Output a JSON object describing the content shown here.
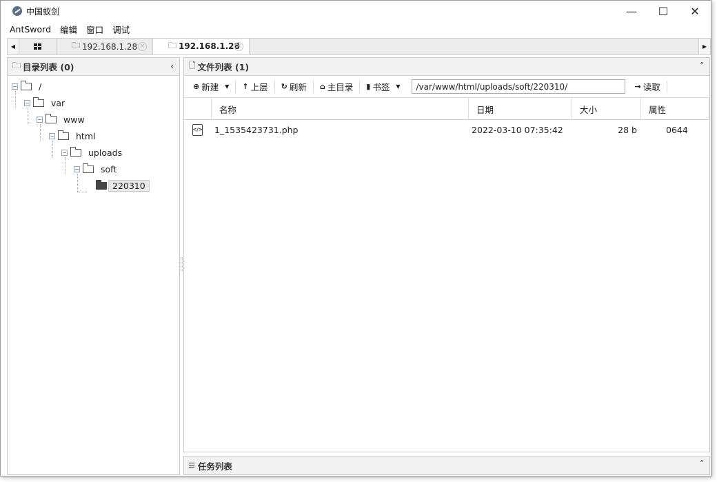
{
  "window": {
    "title": "中国蚁剑",
    "minimize_glyph": "—",
    "maximize_glyph": "☐",
    "close_glyph": "✕"
  },
  "menu": [
    "AntSword",
    "编辑",
    "窗口",
    "调试"
  ],
  "tabs": {
    "items": [
      {
        "label": "192.168.1.28",
        "active": false,
        "close_glyph": "×"
      },
      {
        "label": "192.168.1.28",
        "active": true,
        "close_glyph": "×"
      }
    ],
    "left_arrow": "◀",
    "right_arrow": "▶",
    "folder_glyph": "🗀"
  },
  "dir_panel": {
    "title": "目录列表 (0)",
    "collapse_glyph": "‹",
    "tree": [
      {
        "label": "/",
        "selected": false
      },
      {
        "label": "var",
        "selected": false
      },
      {
        "label": "www",
        "selected": false
      },
      {
        "label": "html",
        "selected": false
      },
      {
        "label": "uploads",
        "selected": false
      },
      {
        "label": "soft",
        "selected": false
      },
      {
        "label": "220310",
        "selected": true
      }
    ],
    "expand_glyph": "−"
  },
  "file_panel": {
    "title": "文件列表 (1)",
    "collapse_glyph": "˄",
    "toolbar": {
      "new_label": "新建",
      "up_label": "上层",
      "refresh_label": "刷新",
      "home_label": "主目录",
      "bookmark_label": "书签",
      "path_value": "/var/www/html/uploads/soft/220310/",
      "read_label": "读取"
    },
    "columns": [
      "名称",
      "日期",
      "大小",
      "属性"
    ],
    "rows": [
      {
        "icon": "php-file-icon",
        "icon_glyph": "</>",
        "name": "1_1535423731.php",
        "date": "2022-03-10 07:35:42",
        "size": "28 b",
        "perm": "0644"
      }
    ]
  },
  "task_panel": {
    "title": "任务列表",
    "collapse_glyph": "˄"
  }
}
